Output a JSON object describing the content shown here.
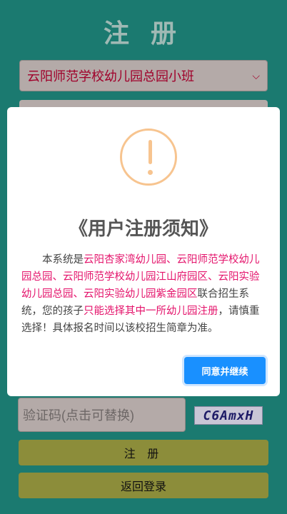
{
  "page": {
    "title": "注 册"
  },
  "form": {
    "kindergarten_select": "云阳师范学校幼儿园总园小班",
    "captcha_placeholder": "验证码(点击可替换)",
    "captcha_text": "C6AmxH",
    "register_label": "注 册",
    "back_label": "返回登录"
  },
  "modal": {
    "icon": "warning-icon",
    "title": "《用户注册须知》",
    "text": {
      "p1": "本系统是",
      "h1": "云阳杏家湾幼儿园、云阳师范学校幼儿园总园、云阳师范学校幼儿园江山府园区、云阳实验幼儿园总园、云阳实验幼儿园紫金园区",
      "p2": "联合招生系统，您的孩子",
      "h2": "只能选择其中一所幼儿园注册",
      "p3": "，请慎重选择！具体报名时间以该校招生简章为准。"
    },
    "agree_label": "同意并继续"
  },
  "colors": {
    "background": "#1b7a70",
    "button_olive": "#8c8d3a",
    "highlight": "#e4136b",
    "primary_button": "#1990ff",
    "warning": "#f7c48f"
  }
}
